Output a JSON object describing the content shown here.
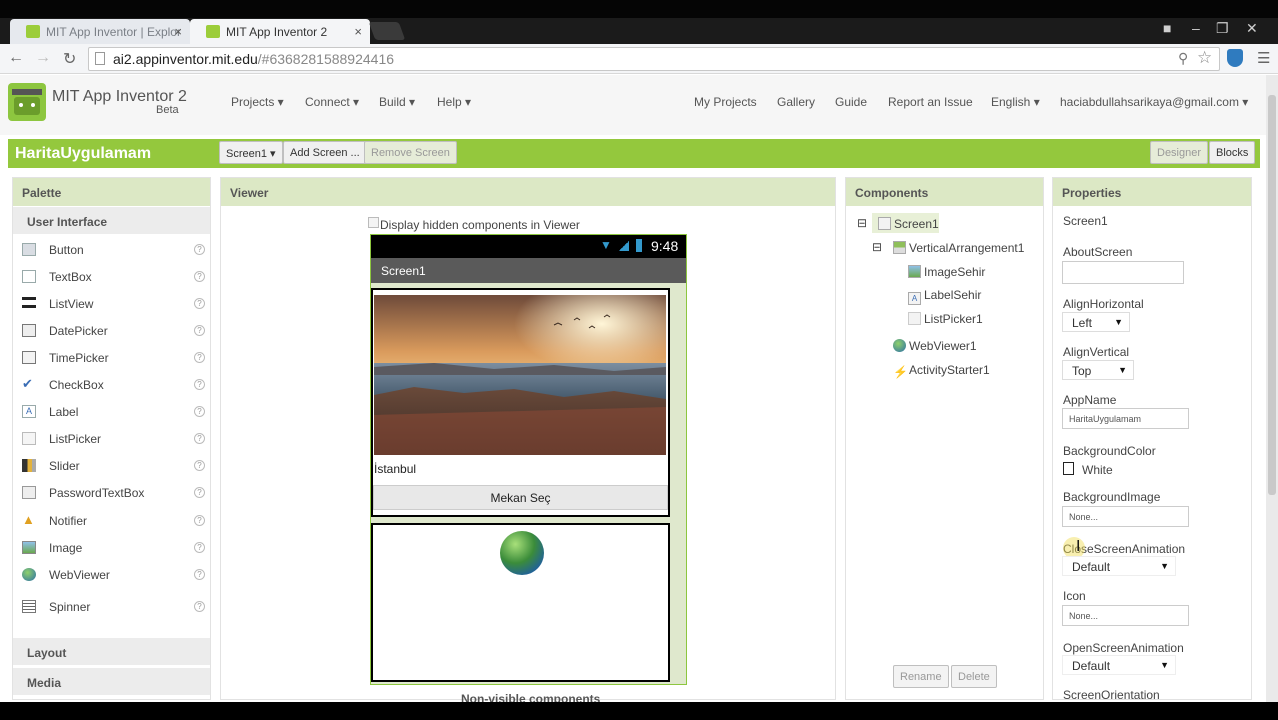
{
  "browser": {
    "tabs": [
      {
        "label": "MIT App Inventor | Explor",
        "active": false
      },
      {
        "label": "MIT App Inventor 2",
        "active": true
      }
    ],
    "url_host": "ai2.appinventor.mit.edu",
    "url_rest": "/#6368281588924416"
  },
  "app": {
    "title": "MIT App Inventor 2",
    "beta": "Beta",
    "menu": [
      "Projects ▾",
      "Connect ▾",
      "Build ▾",
      "Help ▾"
    ],
    "right_menu": [
      "My Projects",
      "Gallery",
      "Guide",
      "Report an Issue",
      "English ▾",
      "haciabdullahsarikaya@gmail.com ▾"
    ]
  },
  "project": {
    "name": "HaritaUygulamam",
    "screen_select": "Screen1 ▾",
    "add_screen": "Add Screen ...",
    "remove_screen": "Remove Screen",
    "designer": "Designer",
    "blocks": "Blocks"
  },
  "palette": {
    "title": "Palette",
    "section": "User Interface",
    "items": [
      "Button",
      "TextBox",
      "ListView",
      "DatePicker",
      "TimePicker",
      "CheckBox",
      "Label",
      "ListPicker",
      "Slider",
      "PasswordTextBox",
      "Notifier",
      "Image",
      "WebViewer",
      "Spinner"
    ],
    "help": "?",
    "groups": [
      "Layout",
      "Media"
    ]
  },
  "viewer": {
    "title": "Viewer",
    "hidden_checkbox": "Display hidden components in Viewer",
    "time": "9:48",
    "screen_title": "Screen1",
    "label_text": "İstanbul",
    "button_text": "Mekan Seç",
    "nonvisible": "Non-visible components"
  },
  "components": {
    "title": "Components",
    "tree": [
      "Screen1",
      "VerticalArrangement1",
      "ImageSehir",
      "LabelSehir",
      "ListPicker1",
      "WebViewer1",
      "ActivityStarter1"
    ],
    "rename": "Rename",
    "delete": "Delete"
  },
  "properties": {
    "title": "Properties",
    "component": "Screen1",
    "about_label": "AboutScreen",
    "align_h_label": "AlignHorizontal",
    "align_h_value": "Left",
    "align_v_label": "AlignVertical",
    "align_v_value": "Top",
    "appname_label": "AppName",
    "appname_value": "HaritaUygulamam",
    "bgcolor_label": "BackgroundColor",
    "bgcolor_value": "White",
    "bgimage_label": "BackgroundImage",
    "bgimage_value": "None...",
    "close_anim_label": "CloseScreenAnimation",
    "close_anim_value": "Default",
    "icon_label": "Icon",
    "icon_value": "None...",
    "open_anim_label": "OpenScreenAnimation",
    "open_anim_value": "Default",
    "orientation_label": "ScreenOrientation"
  },
  "colors": {
    "accent_green": "#94c83d",
    "panel_header": "#dce8c5"
  }
}
